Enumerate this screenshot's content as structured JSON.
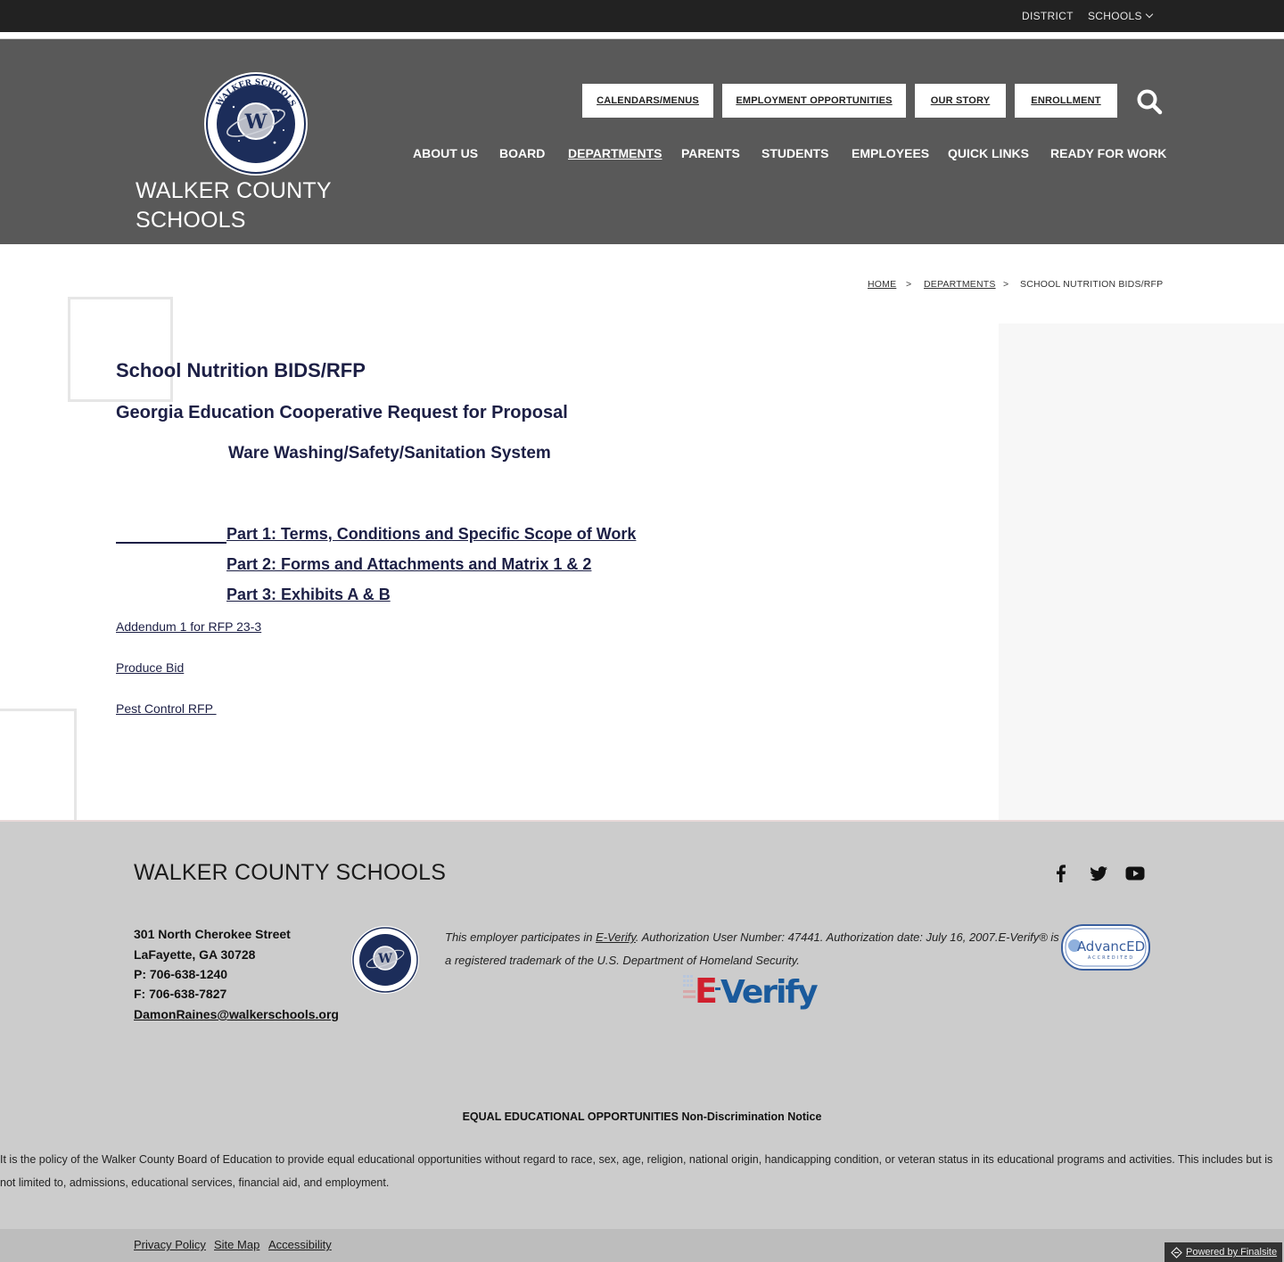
{
  "topbar": {
    "district": "DISTRICT",
    "schools": "SCHOOLS"
  },
  "header": {
    "site_name_line1": "WALKER COUNTY",
    "site_name_line2": "SCHOOLS",
    "quick_links": [
      "CALENDARS/MENUS",
      "EMPLOYMENT OPPORTUNITIES",
      "OUR STORY",
      "ENROLLMENT"
    ],
    "nav": [
      "ABOUT US",
      "BOARD",
      "DEPARTMENTS",
      "PARENTS",
      "STUDENTS",
      "EMPLOYEES",
      "QUICK LINKS",
      "READY FOR WORK"
    ],
    "active_nav": "DEPARTMENTS",
    "logo_text": "WALKER SCHOOLS"
  },
  "breadcrumb": {
    "home": "HOME",
    "sep": ">",
    "departments": "DEPARTMENTS",
    "current": "SCHOOL NUTRITION BIDS/RFP"
  },
  "content": {
    "title": "School Nutrition BIDS/RFP",
    "heading": "Georgia Education Cooperative Request for Proposal",
    "subheading": "Ware Washing/Safety/Sanitation System",
    "parts": [
      "Part 1:  Terms, Conditions and Specific Scope of Work",
      "Part 2:  Forms and Attachments and Matrix 1 & 2",
      "Part 3:  Exhibits A & B"
    ],
    "links": [
      "Addendum 1 for RFP 23-3",
      "Produce Bid",
      "Pest Control RFP "
    ]
  },
  "footer": {
    "name": "WALKER COUNTY SCHOOLS",
    "address": [
      "301 North Cherokee Street",
      "LaFayette, GA 30728",
      "P: 706-638-1240",
      "F: 706-638-7827"
    ],
    "email": "DamonRaines@walkerschools.org",
    "everify_before": "This employer participates in ",
    "everify_link": "E-Verify",
    "everify_after": ". Authorization User Number: 47441. Authorization date: July 16, 2007.E-Verify® is a registered trademark of the U.S. Department of Homeland Security.",
    "everify_logo_e": "E",
    "everify_logo_rest": "Verify",
    "advanced_text": "AdvancED",
    "advanced_sub": "ACCREDITED",
    "eeo_title": "EQUAL EDUCATIONAL OPPORTUNITIES Non-Discrimination Notice",
    "eeo_text": "It is the policy of the Walker County Board of Education to provide equal educational opportunities without regard to race, sex, age, religion, national origin, handicapping condition, or veteran status in its educational programs and activities.  This includes but is not limited to, admissions, educational services, financial aid, and employment.",
    "bottom_links": [
      "Privacy Policy",
      "Site Map",
      "Accessibility"
    ],
    "powered": "Powered by Finalsite"
  },
  "colors": {
    "header_bg": "#595959",
    "topbar_bg": "#222222",
    "content_text": "#1c1f45",
    "footer_bg": "#cccccc",
    "everify_red": "#d0202e",
    "everify_blue": "#1a5a9c"
  },
  "icons": [
    "search-icon",
    "chevron-down-icon",
    "facebook-icon",
    "twitter-icon",
    "youtube-icon",
    "finalsite-icon"
  ]
}
